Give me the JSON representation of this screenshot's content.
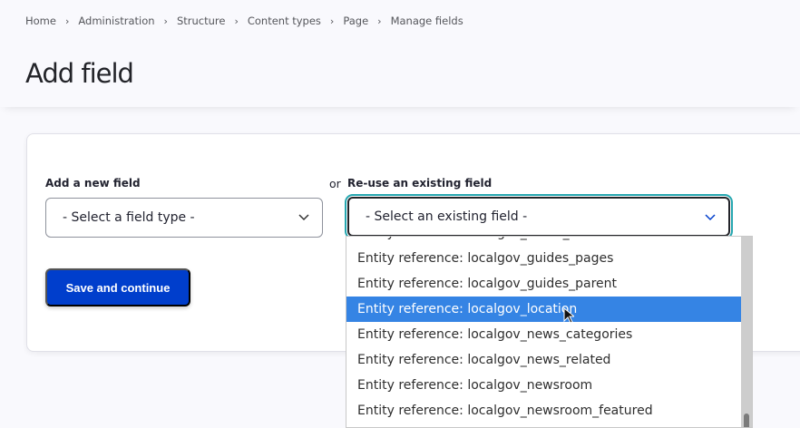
{
  "breadcrumb": [
    "Home",
    "Administration",
    "Structure",
    "Content types",
    "Page",
    "Manage fields"
  ],
  "page_title": "Add field",
  "new_field": {
    "label": "Add a new field",
    "placeholder": "- Select a field type -"
  },
  "or_text": "or",
  "existing_field": {
    "label": "Re-use an existing field",
    "placeholder": "- Select an existing field -"
  },
  "save_label": "Save and continue",
  "options": [
    "Entity reference: localgov_event_venue",
    "Entity reference: localgov_guides_pages",
    "Entity reference: localgov_guides_parent",
    "Entity reference: localgov_location",
    "Entity reference: localgov_news_categories",
    "Entity reference: localgov_news_related",
    "Entity reference: localgov_newsroom",
    "Entity reference: localgov_newsroom_featured"
  ],
  "highlighted_option": "Entity reference: localgov_location",
  "colors": {
    "primary_button": "#003ecc",
    "highlight": "#3584e4",
    "focus_ring": "#26a7b0"
  }
}
